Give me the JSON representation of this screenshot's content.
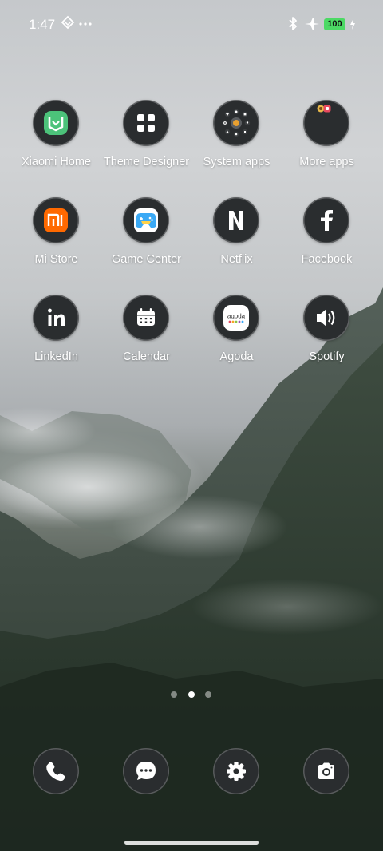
{
  "status_bar": {
    "time": "1:47",
    "battery_level": "100",
    "battery_color": "#4cd964",
    "icons": [
      "cast-icon",
      "more-dots-icon",
      "bluetooth-icon",
      "airplane-mode-icon",
      "battery-icon",
      "charging-icon"
    ]
  },
  "apps": [
    {
      "label": "Xiaomi Home",
      "icon": "xiaomi-home-icon"
    },
    {
      "label": "Theme Designer",
      "icon": "theme-designer-icon"
    },
    {
      "label": "System apps",
      "icon": "folder-icon"
    },
    {
      "label": "More apps",
      "icon": "folder-icon"
    },
    {
      "label": "Mi Store",
      "icon": "mi-store-icon"
    },
    {
      "label": "Game Center",
      "icon": "game-controller-icon"
    },
    {
      "label": "Netflix",
      "icon": "netflix-icon"
    },
    {
      "label": "Facebook",
      "icon": "facebook-icon"
    },
    {
      "label": "LinkedIn",
      "icon": "linkedin-icon"
    },
    {
      "label": "Calendar",
      "icon": "calendar-icon"
    },
    {
      "label": "Agoda",
      "icon": "agoda-icon",
      "logo_text": "agoda"
    },
    {
      "label": "Spotify",
      "icon": "speaker-icon"
    }
  ],
  "page_indicator": {
    "pages": 3,
    "current": 2
  },
  "dock": [
    {
      "app": "Phone",
      "icon": "phone-icon"
    },
    {
      "app": "Messages",
      "icon": "message-icon"
    },
    {
      "app": "Settings",
      "icon": "gear-icon"
    },
    {
      "app": "Camera",
      "icon": "camera-icon"
    }
  ],
  "colors": {
    "icon_background": "#2a2d2f",
    "xiaomi_home_green": "#4cc27a",
    "mi_store_orange": "#ff6900",
    "game_center_blue": "#3aa9f5"
  }
}
